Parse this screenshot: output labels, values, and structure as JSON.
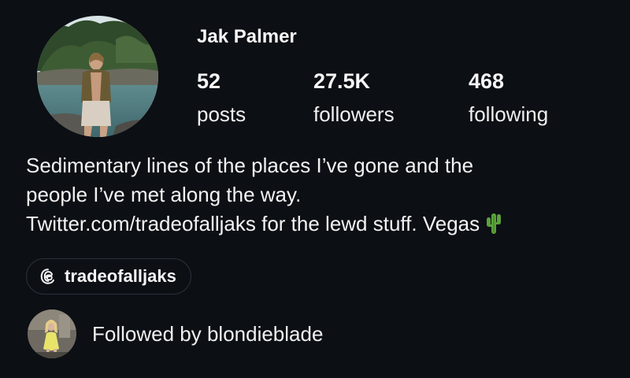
{
  "profile": {
    "name": "Jak Palmer",
    "avatar_icon": "profile-photo",
    "stats": {
      "posts": {
        "value": "52",
        "label": "posts"
      },
      "followers": {
        "value": "27.5K",
        "label": "followers"
      },
      "following": {
        "value": "468",
        "label": "following"
      }
    },
    "bio": {
      "line1": "Sedimentary lines of the places I’ve gone and the",
      "line2": "people I’ve met along the way.",
      "line3": "Twitter.com/tradeofalljaks for the lewd stuff. Vegas",
      "emoji_icon": "cactus-icon"
    },
    "threads": {
      "icon": "threads-icon",
      "handle": "tradeofalljaks"
    },
    "followed_by": {
      "text": "Followed by blondieblade",
      "avatar_icon": "follower-avatar"
    }
  },
  "colors": {
    "background": "#0c0f14",
    "text": "#f5f5f5",
    "chip_border": "#2c3039",
    "cactus": "#5aa33a"
  }
}
